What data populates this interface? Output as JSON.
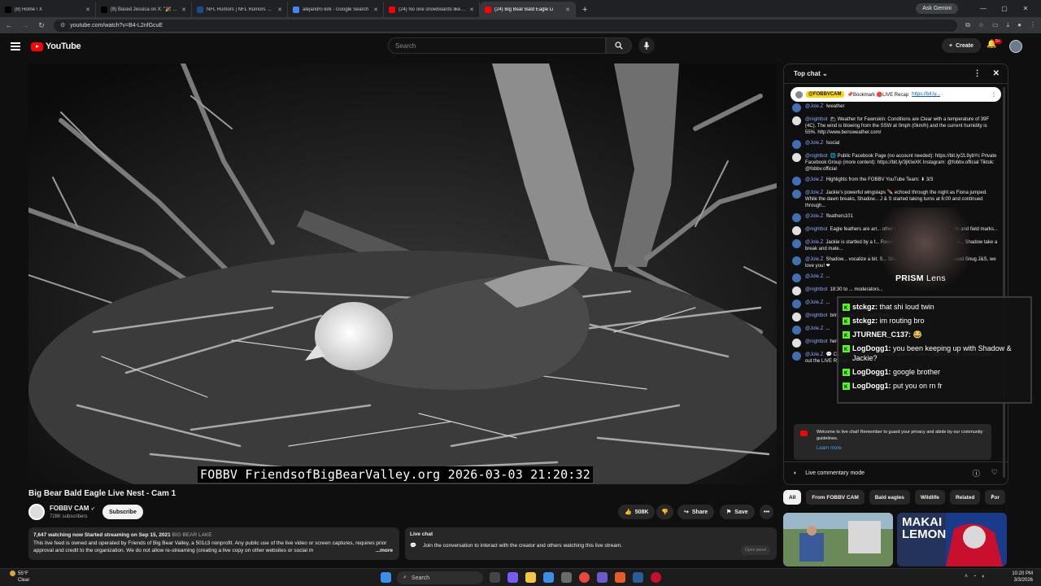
{
  "browser": {
    "tabs": [
      {
        "title": "(8) Home / X",
        "color": "#000000"
      },
      {
        "title": "(8) Based Jessica on X: \"🎉 Arti",
        "color": "#000000"
      },
      {
        "title": "NFL Rumors | NFL Rumors New",
        "color": "#1a4d8c"
      },
      {
        "title": "alejandro kirk - Google Search",
        "color": "#4285f4"
      },
      {
        "title": "(24) No one snowboards like Ze",
        "color": "#ff0000"
      },
      {
        "title": "(24) Big Bear Bald Eagle Li",
        "color": "#ff0000"
      }
    ],
    "ask_gemini": "Ask Gemini",
    "url": "youtube.com/watch?v=B4-L2nfGcuE"
  },
  "yt": {
    "logo": "YouTube",
    "search_placeholder": "Search",
    "create": "Create",
    "notif_count": "9+"
  },
  "video": {
    "overlay": "FOBBV FriendsofBigBearValley.org 2026-03-03 21:20:32",
    "title": "Big Bear Bald Eagle Live Nest - Cam 1",
    "channel": "FOBBV CAM",
    "subs": "728K subscribers",
    "subscribe": "Subscribe",
    "likes": "508K",
    "share": "Share",
    "save": "Save",
    "desc_stats": "7,647 watching now  Started streaming on Sep 15, 2021",
    "desc_loc": "BIG BEAR LAKE",
    "desc_text": "This live feed is owned and operated by Friends of Big Bear Valley, a 501c3 nonprofit. Any public use of the live video or screen captures, requires prior approval and credit to the organization. We do not allow re-streaming (creating a live copy on other websites or social m",
    "more": "...more",
    "livechat_title": "Live chat",
    "livechat_text": "Join the conversation to interact with the creator and others watching this live stream.",
    "open_panel": "Open panel"
  },
  "chat": {
    "header": "Top chat",
    "pinned_tag": "@FOBBVCAM",
    "pinned_text": "📌Bookmark 🔴LIVE Recap",
    "pinned_link": "https://bit.ly...",
    "messages": [
      {
        "author": "@Jole.Z",
        "text": "!weather",
        "color": "#3f6fb5"
      },
      {
        "author": "@nightbot",
        "text": "🌥 Weather for Fawnskin: Conditions are Clear with a temperature of 39F (4C). The wind is blowing from the SSW at 0mph (0km/h) and the current humidity is 55%. http://www.bensweather.com/",
        "color": "#e0e0e0"
      },
      {
        "author": "@Jole.Z",
        "text": "!social",
        "color": "#3f6fb5"
      },
      {
        "author": "@nightbot",
        "text": "🌐 Public Facebook Page (no account needed): https://bit.ly/2L9ybYc Private Facebook Group (more content): https://bit.ly/3jKlwXK Instagram: @fobbv.official Tiktok: @fobbv.official",
        "color": "#e0e0e0"
      },
      {
        "author": "@Jole.Z",
        "text": "Highlights from the FOBBV YouTube Team: ⬇ 3/3",
        "color": "#3f6fb5"
      },
      {
        "author": "@Jole.Z",
        "text": "Jackie's powerful wingslaps 🪶 echoed through the night as Fiona jumped. While the dawn breaks, Shadow... J & S started taking turns at 6:00 and continued through...",
        "color": "#3f6fb5"
      },
      {
        "author": "@Jole.Z",
        "text": "!feathers101",
        "color": "#3f6fb5"
      },
      {
        "author": "@nightbot",
        "text": "Eagle feathers are arr... other groups, plumage areas, tracts and field marks...",
        "color": "#e0e0e0"
      },
      {
        "author": "@Jole.Z",
        "text": "Jackie is startled by a f... Ravens are observed flying by on ca... Shadow take a break and mate...",
        "color": "#3f6fb5"
      },
      {
        "author": "@Jole.Z",
        "text": "Shadow... vocalize a bit. S... Shadow leaves for the night. Roost Snug J&S, we love you! ❤",
        "color": "#3f6fb5"
      },
      {
        "author": "@Jole.Z",
        "text": "...",
        "color": "#3f6fb5"
      },
      {
        "author": "@nightbot",
        "text": "18:30 to ... moderators...",
        "color": "#e0e0e0"
      },
      {
        "author": "@Jole.Z",
        "text": "...",
        "color": "#3f6fb5"
      },
      {
        "author": "@nightbot",
        "text": "bring to the ... Google Form...",
        "color": "#e0e0e0"
      },
      {
        "author": "@Jole.Z",
        "text": "...",
        "color": "#3f6fb5"
      },
      {
        "author": "@nightbot",
        "text": "here: https://...",
        "color": "#e0e0e0"
      },
      {
        "author": "@Jole.Z",
        "text": "💬 Chat is closed and you want updates? Check https://tinyurl.com/ytw7p3es out the LIVE Recap",
        "color": "#3f6fb5"
      }
    ],
    "welcome": "Welcome to live chat! Remember to guard your privacy and abide by our community guidelines.",
    "learn_more": "Learn more",
    "footer": "Live commentary mode"
  },
  "prism": {
    "label_bold": "PRISM",
    "label_rest": " Lens",
    "messages": [
      {
        "name": "stckgz:",
        "text": "that shi loud twin"
      },
      {
        "name": "stckgz:",
        "text": "im routing bro"
      },
      {
        "name": "JTURNER_C137:",
        "text": "😂"
      },
      {
        "name": "LogDogg1:",
        "text": "you been keeping up with Shadow & Jackie?"
      },
      {
        "name": "LogDogg1:",
        "text": "google brother"
      },
      {
        "name": "LogDogg1:",
        "text": "put you on rn fr"
      }
    ]
  },
  "chips": [
    "All",
    "From FOBBV CAM",
    "Bald eagles",
    "Wildlife",
    "Related",
    "For"
  ],
  "thumb2_text": "MAKAI LEMON",
  "taskbar": {
    "temp": "55°F",
    "cond": "Clear",
    "search": "Search",
    "time": "10:20 PM",
    "date": "3/3/2026"
  }
}
